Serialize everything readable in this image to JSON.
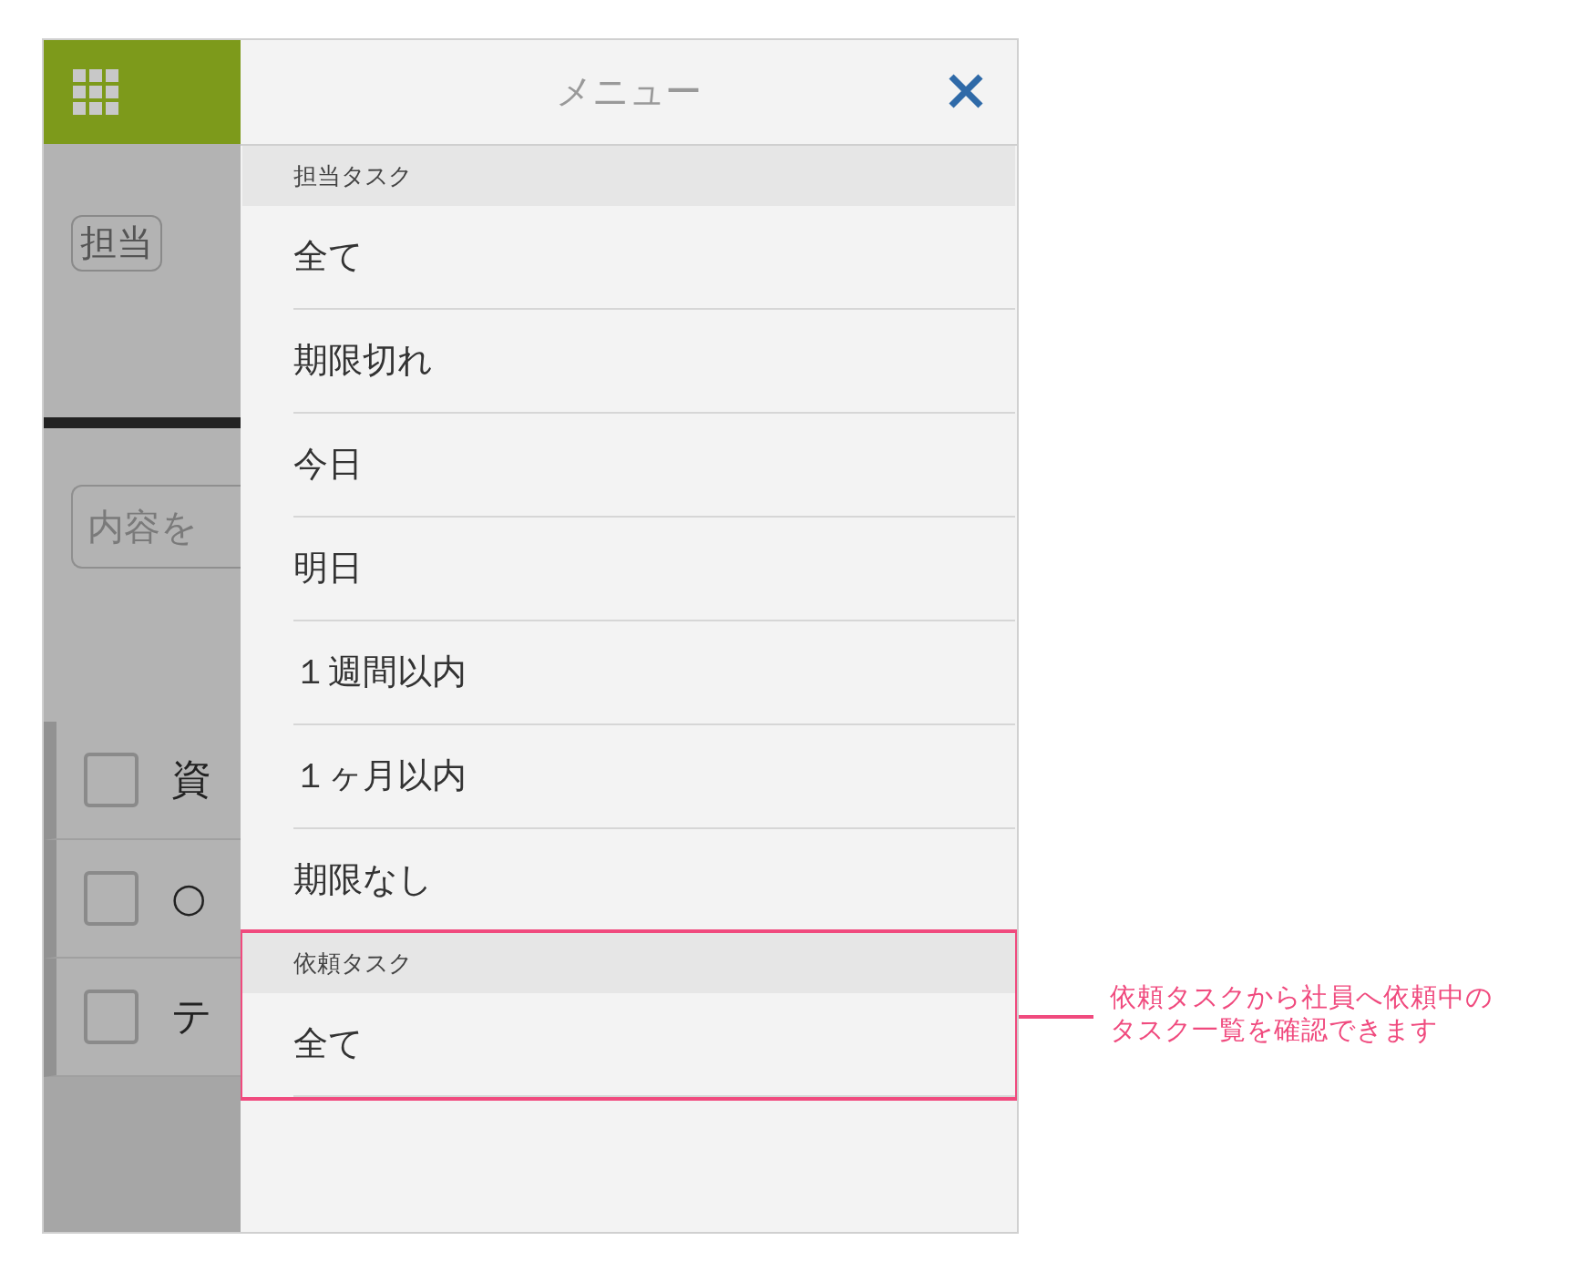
{
  "background_app": {
    "badge": "担当",
    "search": {
      "placeholder": "内容を"
    },
    "tasks": [
      {
        "title": "資",
        "checked": false
      },
      {
        "title": "○",
        "checked": false
      },
      {
        "title": "テ",
        "checked": false
      }
    ]
  },
  "menu": {
    "title": "メニュー",
    "sections": [
      {
        "heading": "担当タスク",
        "highlighted": false,
        "items": [
          "全て",
          "期限切れ",
          "今日",
          "明日",
          "１週間以内",
          "１ヶ月以内",
          "期限なし"
        ]
      },
      {
        "heading": "依頼タスク",
        "highlighted": true,
        "items": [
          "全て"
        ]
      }
    ]
  },
  "annotation": [
    "依頼タスクから社員へ依頼中の",
    "タスク一覧を確認できます"
  ]
}
